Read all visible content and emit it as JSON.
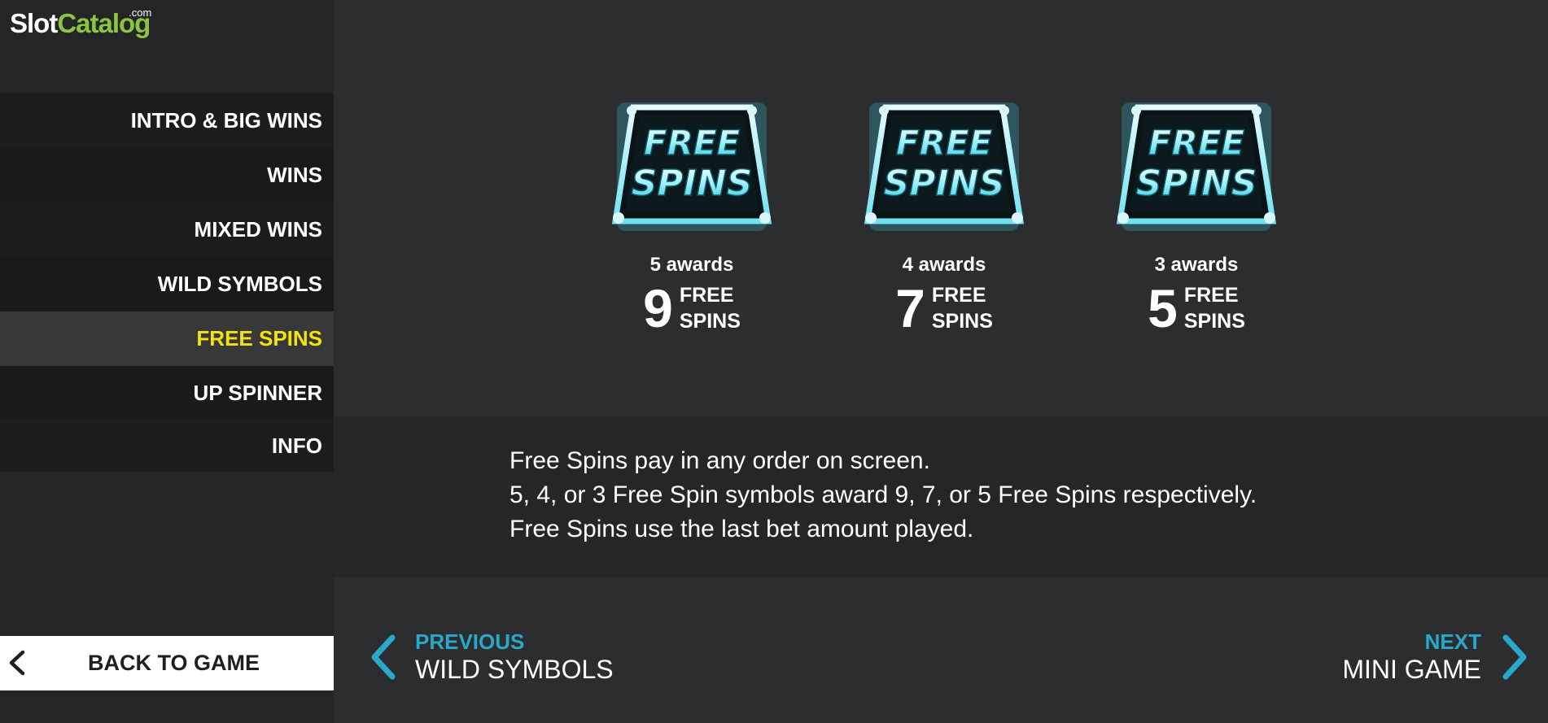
{
  "logo": {
    "brand_first": "Slot",
    "brand_second": "Catalog",
    "suffix": ".com"
  },
  "sidebar": {
    "items": [
      {
        "label": "INTRO & BIG WINS",
        "active": false
      },
      {
        "label": "WINS",
        "active": false
      },
      {
        "label": "MIXED WINS",
        "active": false
      },
      {
        "label": "WILD SYMBOLS",
        "active": false
      },
      {
        "label": "FREE SPINS",
        "active": true
      },
      {
        "label": "UP SPINNER",
        "active": false
      },
      {
        "label": "INFO",
        "active": false
      }
    ],
    "back_label": "BACK TO GAME"
  },
  "symbols": [
    {
      "icon": "free-spins-symbol-icon",
      "symbol_text_top": "FREE",
      "symbol_text_bottom": "SPINS",
      "awards": "5 awards",
      "count": "9",
      "unit_top": "FREE",
      "unit_bottom": "SPINS"
    },
    {
      "icon": "free-spins-symbol-icon",
      "symbol_text_top": "FREE",
      "symbol_text_bottom": "SPINS",
      "awards": "4 awards",
      "count": "7",
      "unit_top": "FREE",
      "unit_bottom": "SPINS"
    },
    {
      "icon": "free-spins-symbol-icon",
      "symbol_text_top": "FREE",
      "symbol_text_bottom": "SPINS",
      "awards": "3 awards",
      "count": "5",
      "unit_top": "FREE",
      "unit_bottom": "SPINS"
    }
  ],
  "description": {
    "lines": [
      "Free Spins pay in any order on screen.",
      "5, 4, or 3 Free Spin symbols award 9, 7, or 5 Free Spins respectively.",
      "Free Spins use the last bet amount played."
    ]
  },
  "navigation": {
    "prev_caption": "PREVIOUS",
    "prev_target": "WILD SYMBOLS",
    "next_caption": "NEXT",
    "next_target": "MINI GAME"
  },
  "colors": {
    "accent_cyan": "#2aa8c9",
    "active_yellow": "#f2e30d",
    "brand_green": "#8cc63f",
    "background": "#2c2d2f"
  }
}
